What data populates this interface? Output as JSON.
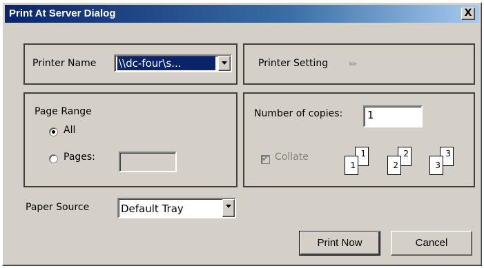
{
  "dialog": {
    "title": "Print At Server Dialog",
    "close_label": "X"
  },
  "printer": {
    "name_label": "Printer Name",
    "name_value": "\\\\dc-four\\s...",
    "setting_label": "Printer Setting",
    "setting_icon": "double-chevron-right-icon"
  },
  "page_range": {
    "label": "Page Range",
    "all_label": "All",
    "pages_label": "Pages:",
    "pages_value": "",
    "selected": "All"
  },
  "copies": {
    "label": "Number of copies:",
    "value": "1",
    "collate_label": "Collate",
    "collate_checked": true,
    "collate_enabled": false,
    "collate_pages": [
      "1",
      "2",
      "3"
    ]
  },
  "paper": {
    "label": "Paper Source",
    "value": "Default Tray"
  },
  "buttons": {
    "print_now": "Print Now",
    "cancel": "Cancel"
  }
}
